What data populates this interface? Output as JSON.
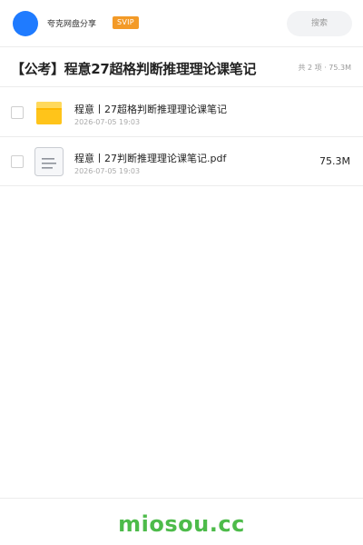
{
  "header": {
    "username": "夸克网盘分享",
    "badge": "SVIP",
    "search_placeholder": "搜索"
  },
  "share": {
    "title": "【公考】程意27超格判断推理理论课笔记",
    "summary": "共 2 项 · 75.3M"
  },
  "files": [
    {
      "name": "程意丨27超格判断推理理论课笔记",
      "date": "2026-07-05 19:03",
      "size": "",
      "type": "folder-icon"
    },
    {
      "name": "程意丨27判断推理理论课笔记.pdf",
      "date": "2026-07-05 19:03",
      "size": "75.3M",
      "type": "document-icon"
    }
  ],
  "footer": {
    "watermark": "miosou.cc"
  },
  "colors": {
    "accent": "#1f7bff",
    "svip": "#f39a27",
    "folder": "#ffc41a",
    "watermark": "#4dbb4a"
  }
}
